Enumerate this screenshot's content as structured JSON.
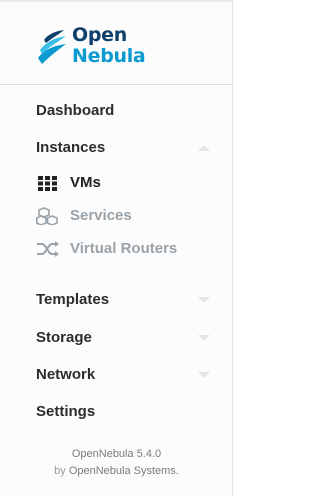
{
  "logo": {
    "line1": "Open",
    "line2": "Nebula"
  },
  "menu": {
    "dashboard": "Dashboard",
    "instances": "Instances",
    "templates": "Templates",
    "storage": "Storage",
    "network": "Network",
    "settings": "Settings"
  },
  "instances_sub": {
    "vms": {
      "label": "VMs",
      "icon": "grid-icon"
    },
    "services": {
      "label": "Services",
      "icon": "cubes-icon"
    },
    "virtual_routers": {
      "label": "Virtual Routers",
      "icon": "shuffle-icon"
    }
  },
  "footer": {
    "version": "OpenNebula 5.4.0",
    "by": "by",
    "company": "OpenNebula Systems."
  },
  "colors": {
    "brand_dark": "#0f3f6b",
    "brand_light": "#0a9ad0",
    "muted": "#9aa3a9"
  }
}
